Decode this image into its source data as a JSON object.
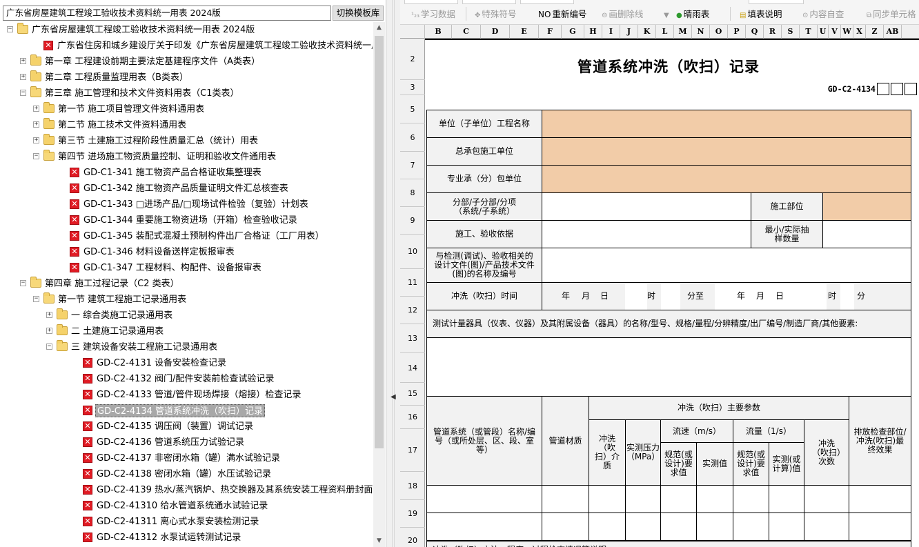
{
  "library": {
    "title": "广东省房屋建筑工程竣工验收技术资料统一用表 2024版",
    "switch_button": "切换模板库"
  },
  "tree": [
    {
      "indent": 0,
      "toggle": "minus",
      "icon": "folder-open",
      "label": "广东省房屋建筑工程竣工验收技术资料统一用表 2024版"
    },
    {
      "indent": 1,
      "toggle": "",
      "icon": "x",
      "label": "广东省住房和城乡建设厅关于印发《广东省房屋建筑工程竣工验收技术资料统一用表"
    },
    {
      "indent": 1,
      "toggle": "plus",
      "icon": "folder",
      "label": "第一章 工程建设前期主要法定基建程序文件（A类表）"
    },
    {
      "indent": 1,
      "toggle": "plus",
      "icon": "folder",
      "label": "第二章 工程质量监理用表（B类表）"
    },
    {
      "indent": 1,
      "toggle": "minus",
      "icon": "folder-open",
      "label": "第三章 施工管理和技术文件资料用表（C1类表）"
    },
    {
      "indent": 2,
      "toggle": "plus",
      "icon": "folder",
      "label": "第一节 施工项目管理文件资料通用表"
    },
    {
      "indent": 2,
      "toggle": "plus",
      "icon": "folder",
      "label": "第二节 施工技术文件资料通用表"
    },
    {
      "indent": 2,
      "toggle": "plus",
      "icon": "folder",
      "label": "第三节 土建施工过程阶段性质量汇总（统计）用表"
    },
    {
      "indent": 2,
      "toggle": "minus",
      "icon": "folder-open",
      "label": "第四节 进场施工物资质量控制、证明和验收文件通用表"
    },
    {
      "indent": 3,
      "toggle": "",
      "icon": "x",
      "label": "GD-C1-341 施工物资产品合格证收集整理表"
    },
    {
      "indent": 3,
      "toggle": "",
      "icon": "x",
      "label": "GD-C1-342 施工物资产品质量证明文件汇总核查表"
    },
    {
      "indent": 3,
      "toggle": "",
      "icon": "x",
      "label": "GD-C1-343 □进场产品/□现场试件检验（复验）计划表"
    },
    {
      "indent": 3,
      "toggle": "",
      "icon": "x",
      "label": "GD-C1-344 重要施工物资进场（开箱）检查验收记录"
    },
    {
      "indent": 3,
      "toggle": "",
      "icon": "x",
      "label": "GD-C1-345 装配式混凝土预制构件出厂合格证（工厂用表）"
    },
    {
      "indent": 3,
      "toggle": "",
      "icon": "x",
      "label": "GD-C1-346 材料设备送样定板报审表"
    },
    {
      "indent": 3,
      "toggle": "",
      "icon": "x",
      "label": "GD-C1-347 工程材料、构配件、设备报审表"
    },
    {
      "indent": 1,
      "toggle": "minus",
      "icon": "folder-open",
      "label": "第四章 施工过程记录（C2 类表）"
    },
    {
      "indent": 2,
      "toggle": "minus",
      "icon": "folder-open",
      "label": "第一节 建筑工程施工记录通用表"
    },
    {
      "indent": 3,
      "toggle": "plus",
      "icon": "folder",
      "label": "一 综合类施工记录通用表"
    },
    {
      "indent": 3,
      "toggle": "plus",
      "icon": "folder",
      "label": "二 土建施工记录通用表"
    },
    {
      "indent": 3,
      "toggle": "minus",
      "icon": "folder-open",
      "label": "三 建筑设备安装工程施工记录通用表"
    },
    {
      "indent": 4,
      "toggle": "",
      "icon": "x",
      "label": "GD-C2-4131 设备安装检查记录"
    },
    {
      "indent": 4,
      "toggle": "",
      "icon": "x",
      "label": "GD-C2-4132 阀门/配件安装前检查试验记录"
    },
    {
      "indent": 4,
      "toggle": "",
      "icon": "x",
      "label": "GD-C2-4133 管道/管件现场焊接（熔接）检查记录"
    },
    {
      "indent": 4,
      "toggle": "",
      "icon": "x",
      "label": "GD-C2-4134 管道系统冲洗（吹扫）记录",
      "selected": true
    },
    {
      "indent": 4,
      "toggle": "",
      "icon": "x",
      "label": "GD-C2-4135 调压阀（装置）调试记录"
    },
    {
      "indent": 4,
      "toggle": "",
      "icon": "x",
      "label": "GD-C2-4136 管道系统压力试验记录"
    },
    {
      "indent": 4,
      "toggle": "",
      "icon": "x",
      "label": "GD-C2-4137 非密闭水箱（罐）满水试验记录"
    },
    {
      "indent": 4,
      "toggle": "",
      "icon": "x",
      "label": "GD-C2-4138 密闭水箱（罐）水压试验记录"
    },
    {
      "indent": 4,
      "toggle": "",
      "icon": "x",
      "label": "GD-C2-4139 热水/蒸汽锅炉、热交换器及其系统安装工程资料册封面"
    },
    {
      "indent": 4,
      "toggle": "",
      "icon": "x",
      "label": "GD-C2-41310 给水管道系统通水试验记录"
    },
    {
      "indent": 4,
      "toggle": "",
      "icon": "x",
      "label": "GD-C2-41311 离心式水泵安装检测记录"
    },
    {
      "indent": 4,
      "toggle": "",
      "icon": "x",
      "label": "GD-C2-41312 水泵试运转测试记录"
    }
  ],
  "toolbar": {
    "learn": "学习数据",
    "special": "特殊符号",
    "renumber": "重新编号",
    "strike": "画删除线",
    "weather": "晴雨表",
    "instructions": "填表说明",
    "selfcheck": "内容自查",
    "sync": "同步单元格"
  },
  "columns": [
    "B",
    "C",
    "D",
    "E",
    "F",
    "G",
    "H",
    "I",
    "J",
    "K",
    "L",
    "M",
    "N",
    "O",
    "P",
    "Q",
    "R",
    "S",
    "T",
    "U",
    "V",
    "W",
    "X",
    "Z",
    "AB"
  ],
  "rows": [
    "2",
    "3",
    "5",
    "6",
    "7",
    "8",
    "9",
    "10",
    "11",
    "12",
    "13",
    "14",
    "15",
    "16",
    "17",
    "18",
    "19",
    "20"
  ],
  "form": {
    "title": "管道系统冲洗（吹扫）记录",
    "code": "GD-C2-4134",
    "unit_name_label": "单位（子单位）工程名称",
    "general_contractor_label": "总承包施工单位",
    "sub_contractor_label": "专业承（分）包单位",
    "division_label": "分部/子分部/分项（系统/子系统）",
    "location_label": "施工部位",
    "basis_label": "施工、验收依据",
    "sample_label": "最小/实际抽样数量",
    "design_docs_label": "与检测(调试)、验收相关的设计文件(图)/产品技术文件(图)的名称及编号",
    "time_label": "冲洗（吹扫）时间",
    "time_parts": {
      "y1": "年",
      "m1": "月",
      "d1": "日",
      "h1": "时",
      "min_to": "分至",
      "y2": "年",
      "m2": "月",
      "d2": "日",
      "h2": "时",
      "min2": "分"
    },
    "instruments_label": "测试计量器具（仪表、仪器）及其附属设备（器具）的名称/型号、规格/量程/分辨精度/出厂编号/制造厂商/其他要素:",
    "main_params": "冲洗（吹扫）主要参数",
    "col_system": "管道系统（或管段）名称/编号（或所处层、区、段、室等）",
    "col_material": "管道材质",
    "col_medium": "冲洗（吹扫）介质",
    "col_pressure": "实测压力（MPa）",
    "col_velocity": "流速（m/s）",
    "col_flow": "流量（1/s）",
    "col_vel_req": "规范(或设计)要求值",
    "col_vel_act": "实测值",
    "col_flow_req": "规范(或设计)要求值",
    "col_flow_act": "实测(或计算)值",
    "col_times": "冲洗（吹扫）次数",
    "col_result": "排放检查部位/冲洗(吹扫)最终效果",
    "method_label": "冲洗（吹扫）方法、程序、过程检查情况等说明:"
  }
}
